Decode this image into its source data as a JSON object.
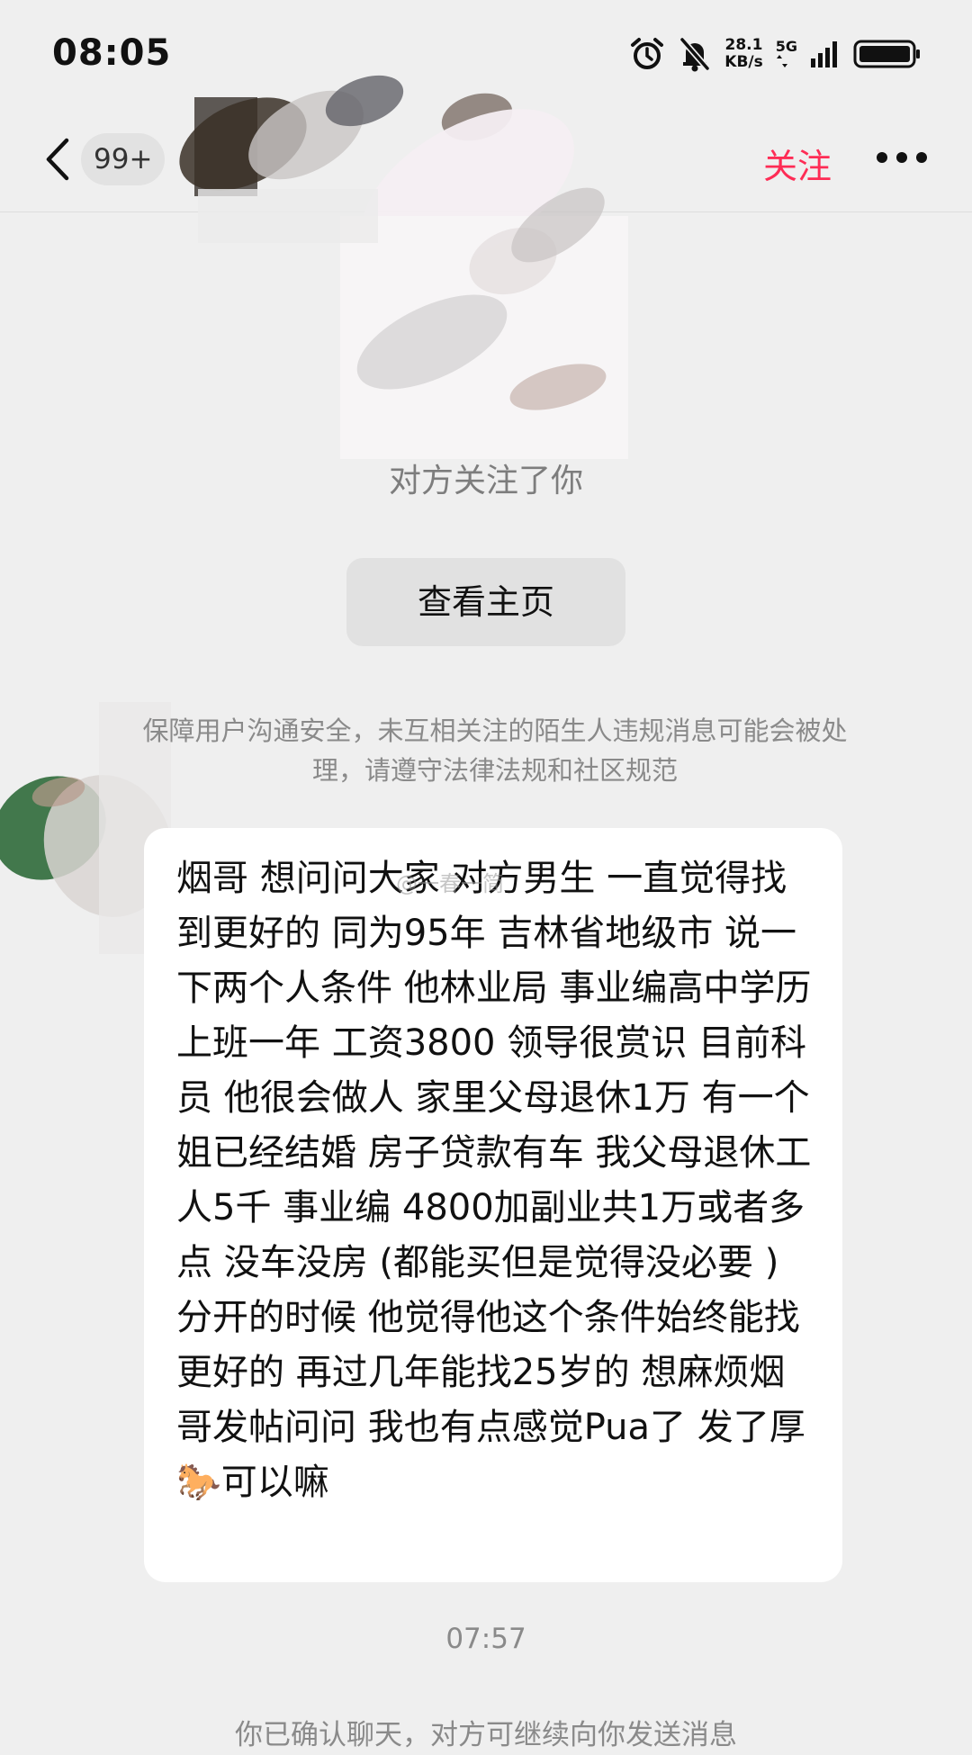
{
  "status_bar": {
    "time": "08:05",
    "net_speed_value": "28.1",
    "net_speed_unit": "KB/s",
    "network_type": "5G",
    "icons": [
      "alarm-icon",
      "mute-bell-icon",
      "signal-icon",
      "battery-icon"
    ]
  },
  "nav": {
    "unread_count": "99+",
    "follow_label": "关注",
    "icons": [
      "back-chevron-icon",
      "more-dots-icon"
    ]
  },
  "chat": {
    "followed_notice": "对方关注了你",
    "view_profile_label": "查看主页",
    "safety_notice": "保障用户沟通安全，未互相关注的陌生人违规消息可能会被处理，请遵守法律法规和社区规范",
    "message_text": "烟哥  想问问大家 对方男生 一直觉得找到更好的 同为95年 吉林省地级市 说一下两个人条件 他林业局 事业编高中学历 上班一年 工资3800 领导很赏识 目前科员 他很会做人 家里父母退休1万 有一个姐已经结婚 房子贷款有车  我父母退休工人5千 事业编 4800加副业共1万或者多点 没车没房 (都能买但是觉得没必要 ) 分开的时候 他觉得他这个条件始终能找更好的 再过几年能找25岁的  想麻烦烟哥发帖问问 我也有点感觉Pua了 发了厚🐎可以嘛",
    "watermark": "@一春一简",
    "message_time": "07:57",
    "confirm_notice": "你已确认聊天，对方可继续向你发送消息"
  },
  "colors": {
    "background": "#efefef",
    "accent_follow": "#fe2c55",
    "bubble": "#ffffff",
    "muted_text": "#8a8a8a"
  }
}
